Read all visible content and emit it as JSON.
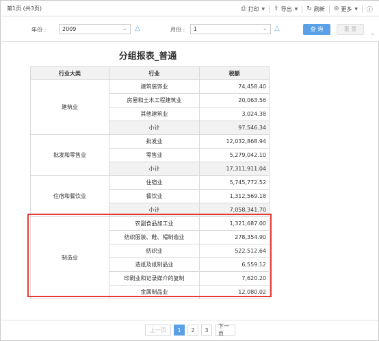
{
  "toolbar": {
    "page_indicator": "第1页 (共3页)",
    "print": {
      "label": "打印",
      "icon": "printer-icon"
    },
    "export": {
      "label": "导出",
      "icon": "export-icon"
    },
    "refresh": {
      "label": "刷新",
      "icon": "refresh-icon"
    },
    "more": {
      "label": "更多",
      "icon": "more-icon"
    },
    "help_icon": "help-icon"
  },
  "filters": {
    "year_label": "年份 :",
    "year_value": "2009",
    "month_label": "月份 :",
    "month_value": "1",
    "query_label": "查 询",
    "reset_label": "重 置"
  },
  "report": {
    "title": "分组报表_普通",
    "headers": [
      "行业大类",
      "行业",
      "税额"
    ],
    "groups": [
      {
        "category": "建筑业",
        "rows": [
          {
            "industry": "建筑装饰业",
            "tax": "74,458.40"
          },
          {
            "industry": "房屋和土木工程建筑业",
            "tax": "20,063.56"
          },
          {
            "industry": "其他建筑业",
            "tax": "3,024.38"
          }
        ],
        "subtotal_label": "小计",
        "subtotal": "97,546.34"
      },
      {
        "category": "批发和零售业",
        "rows": [
          {
            "industry": "批发业",
            "tax": "12,032,868.94"
          },
          {
            "industry": "零售业",
            "tax": "5,279,042.10"
          }
        ],
        "subtotal_label": "小计",
        "subtotal": "17,311,911.04"
      },
      {
        "category": "住宿和餐饮业",
        "rows": [
          {
            "industry": "住宿业",
            "tax": "5,745,772.52"
          },
          {
            "industry": "餐饮业",
            "tax": "1,312,569.18"
          }
        ],
        "subtotal_label": "小计",
        "subtotal": "7,058,341.70"
      },
      {
        "category": "制造业",
        "rows": [
          {
            "industry": "农副食品加工业",
            "tax": "1,321,687.00"
          },
          {
            "industry": "纺织服装、鞋、帽制造业",
            "tax": "278,354.90"
          },
          {
            "industry": "纺织业",
            "tax": "522,512.64"
          },
          {
            "industry": "造纸及纸制品业",
            "tax": "6,559.12"
          },
          {
            "industry": "印刷业和记录媒介的复制",
            "tax": "7,620.20"
          },
          {
            "industry": "金属制品业",
            "tax": "12,080.02"
          }
        ]
      }
    ]
  },
  "pager": {
    "prev": "上一页",
    "pages": [
      "1",
      "2",
      "3"
    ],
    "next": "下一页",
    "current": "1"
  },
  "colors": {
    "accent": "#5aa0e6",
    "highlight": "#e53935"
  }
}
